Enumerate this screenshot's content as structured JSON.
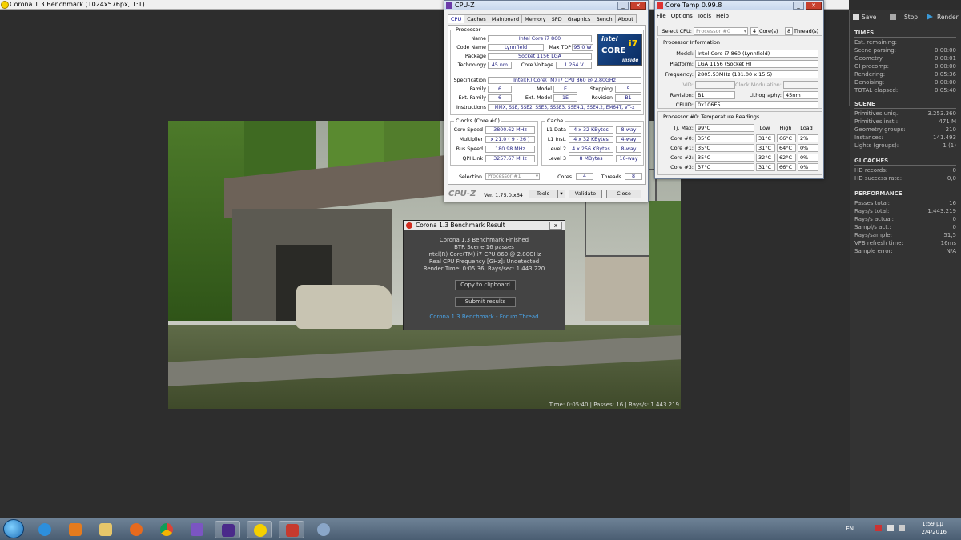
{
  "corona": {
    "title": "Corona 1.3 Benchmark (1024x576px, 1:1)",
    "status": "Time: 0:05:40 | Passes: 16 | Rays/s: 1.443.219",
    "toolbar": {
      "save": "Save",
      "stop": "Stop",
      "render": "Render"
    },
    "times": {
      "header": "TIMES",
      "rows": [
        {
          "label": "Est. remaining:",
          "value": ""
        },
        {
          "label": "Scene parsing:",
          "value": "0:00:00"
        },
        {
          "label": "Geometry:",
          "value": "0:00:01"
        },
        {
          "label": "GI precomp:",
          "value": "0:00:00"
        },
        {
          "label": "Rendering:",
          "value": "0:05:36"
        },
        {
          "label": "Denoising:",
          "value": "0:00:00"
        },
        {
          "label": "TOTAL elapsed:",
          "value": "0:05:40"
        }
      ]
    },
    "scene": {
      "header": "SCENE",
      "rows": [
        {
          "label": "Primitives uniq.:",
          "value": "3.253.360"
        },
        {
          "label": "Primitives inst.:",
          "value": "471 M"
        },
        {
          "label": "Geometry groups:",
          "value": "210"
        },
        {
          "label": "Instances:",
          "value": "141.493"
        },
        {
          "label": "Lights (groups):",
          "value": "1 (1)"
        }
      ]
    },
    "gi": {
      "header": "GI CACHES",
      "rows": [
        {
          "label": "HD records:",
          "value": "0"
        },
        {
          "label": "HD success rate:",
          "value": "0,0"
        }
      ]
    },
    "perf": {
      "header": "PERFORMANCE",
      "rows": [
        {
          "label": "Passes total:",
          "value": "16"
        },
        {
          "label": "Rays/s total:",
          "value": "1.443.219"
        },
        {
          "label": "Rays/s actual:",
          "value": "0"
        },
        {
          "label": "Sampl/s act.:",
          "value": "0"
        },
        {
          "label": "Rays/sample:",
          "value": "51,5"
        },
        {
          "label": "VFB refresh time:",
          "value": "16ms"
        },
        {
          "label": "Sample error:",
          "value": "N/A"
        }
      ]
    }
  },
  "dialog": {
    "title": "Corona 1.3 Benchmark Result",
    "lines": [
      "Corona 1.3 Benchmark Finished",
      "BTR Scene 16 passes",
      "Intel(R) Core(TM) i7 CPU 860 @ 2.80GHz",
      "Real CPU Frequency [GHz]: Undetected",
      "Render Time: 0:05:36, Rays/sec: 1.443.220"
    ],
    "copy": "Copy to clipboard",
    "submit": "Submit results",
    "link": "Corona 1.3 Benchmark - Forum Thread",
    "close": "x"
  },
  "cpuz": {
    "title": "CPU-Z",
    "tabs": [
      "CPU",
      "Caches",
      "Mainboard",
      "Memory",
      "SPD",
      "Graphics",
      "Bench",
      "About"
    ],
    "processor_label": "Processor",
    "name_l": "Name",
    "name": "Intel Core i7 860",
    "codename_l": "Code Name",
    "codename": "Lynnfield",
    "tdp_l": "Max TDP",
    "tdp": "95.0 W",
    "package_l": "Package",
    "package": "Socket 1156 LGA",
    "tech_l": "Technology",
    "tech": "45 nm",
    "voltage_l": "Core Voltage",
    "voltage": "1.264 V",
    "spec_l": "Specification",
    "spec": "Intel(R) Core(TM) i7 CPU       860  @ 2.80GHz",
    "family_l": "Family",
    "family": "6",
    "model_l": "Model",
    "model": "E",
    "stepping_l": "Stepping",
    "stepping": "5",
    "extfam_l": "Ext. Family",
    "extfam": "6",
    "extmodel_l": "Ext. Model",
    "extmodel": "1E",
    "revision_l": "Revision",
    "revision": "B1",
    "instr_l": "Instructions",
    "instr": "MMX, SSE, SSE2, SSE3, SSSE3, SSE4.1, SSE4.2, EM64T, VT-x",
    "clocks_label": "Clocks (Core #0)",
    "corespeed_l": "Core Speed",
    "corespeed": "3800.62 MHz",
    "mult_l": "Multiplier",
    "mult": "x 21.0 ( 9 - 26 )",
    "bus_l": "Bus Speed",
    "bus": "180.98 MHz",
    "qpi_l": "QPI Link",
    "qpi": "3257.67 MHz",
    "cache_label": "Cache",
    "l1d_l": "L1 Data",
    "l1d": "4 x 32 KBytes",
    "l1d_w": "8-way",
    "l1i_l": "L1 Inst.",
    "l1i": "4 x 32 KBytes",
    "l1i_w": "4-way",
    "l2_l": "Level 2",
    "l2": "4 x 256 KBytes",
    "l2_w": "8-way",
    "l3_l": "Level 3",
    "l3": "8 MBytes",
    "l3_w": "16-way",
    "selection_l": "Selection",
    "selection": "Processor #1",
    "cores_l": "Cores",
    "cores": "4",
    "threads_l": "Threads",
    "threads": "8",
    "logo_brand": "CPU-Z",
    "version": "Ver. 1.75.0.x64",
    "tools": "Tools",
    "validate": "Validate",
    "close": "Close",
    "intel_top": "intel",
    "intel_core": "CORE",
    "intel_i7": "i7",
    "intel_inside": "inside"
  },
  "coretemp": {
    "title": "Core Temp 0.99.8",
    "menu": [
      "File",
      "Options",
      "Tools",
      "Help"
    ],
    "select_l": "Select CPU:",
    "select": "Processor #0",
    "cores": "4",
    "cores_l": "Core(s)",
    "threads": "8",
    "threads_l": "Thread(s)",
    "info_label": "Processor Information",
    "model_l": "Model:",
    "model": "Intel Core i7 860 (Lynnfield)",
    "platform_l": "Platform:",
    "platform": "LGA 1156 (Socket H)",
    "freq_l": "Frequency:",
    "freq": "2805.53MHz (181.00 x 15.5)",
    "vid_l": "VID:",
    "vid": "",
    "clockmod_l": "Clock Modulation:",
    "clockmod": "",
    "rev_l": "Revision:",
    "rev": "B1",
    "litho_l": "Lithography:",
    "litho": "45nm",
    "cpuid_l": "CPUID:",
    "cpuid": "0x106E5",
    "temps_label": "Processor #0: Temperature Readings",
    "tj_l": "Tj. Max:",
    "tj": "99°C",
    "col_low": "Low",
    "col_high": "High",
    "col_load": "Load",
    "rows": [
      {
        "label": "Core #0:",
        "temp": "35°C",
        "low": "31°C",
        "high": "66°C",
        "load": "2%"
      },
      {
        "label": "Core #1:",
        "temp": "35°C",
        "low": "31°C",
        "high": "64°C",
        "load": "0%"
      },
      {
        "label": "Core #2:",
        "temp": "35°C",
        "low": "32°C",
        "high": "62°C",
        "load": "0%"
      },
      {
        "label": "Core #3:",
        "temp": "37°C",
        "low": "31°C",
        "high": "66°C",
        "load": "0%"
      }
    ]
  },
  "taskbar": {
    "lang": "EN",
    "time": "1:59 μμ",
    "date": "2/4/2016"
  }
}
